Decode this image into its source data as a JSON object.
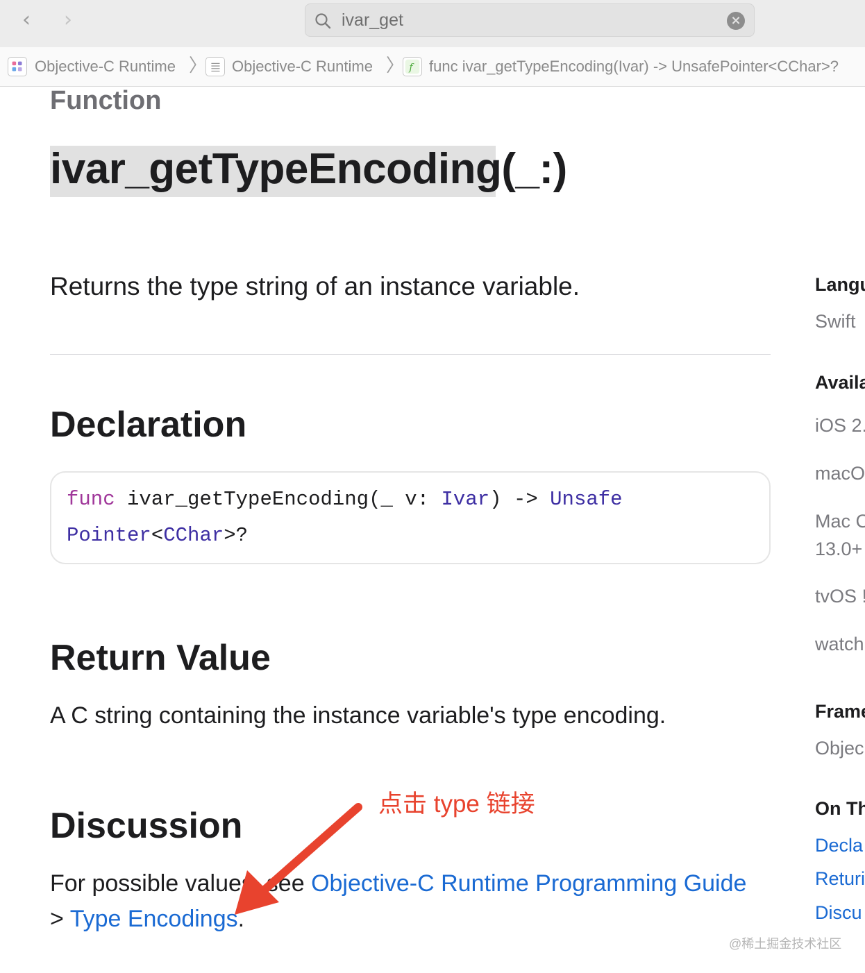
{
  "toolbar": {
    "back_icon": "chevron-left-icon",
    "forward_icon": "chevron-right-icon",
    "search": {
      "value": "ivar_get",
      "icon": "search-icon",
      "clear_icon": "clear-icon"
    }
  },
  "breadcrumb": {
    "items": [
      {
        "label": "Objective-C Runtime",
        "icon": "framework-icon"
      },
      {
        "label": "Objective-C Runtime",
        "icon": "list-icon"
      },
      {
        "label": "func ivar_getTypeEncoding(Ivar) -> UnsafePointer<CChar>?",
        "icon": "function-icon"
      }
    ]
  },
  "doc": {
    "kind": "Function",
    "title": "ivar_getTypeEncoding(_:)",
    "abstract": "Returns the type string of an instance variable.",
    "declaration": {
      "heading": "Declaration",
      "kw_func": "func",
      "name_open": " ivar_getTypeEncoding(_ v: ",
      "type_ivar": "Ivar",
      "arrow": ") -> ",
      "type_unsafe": "Unsafe",
      "type_pointer": "Pointer",
      "lt": "<",
      "type_cchar": "CChar",
      "tail": ">?"
    },
    "return_value": {
      "heading": "Return Value",
      "text": "A C string containing the instance variable's type encoding."
    },
    "discussion": {
      "heading": "Discussion",
      "prefix": "For possible values, see ",
      "link_guide": "Objective-C Runtime Programming Guide",
      "gt": "> ",
      "link_encodings": "Type Encodings",
      "suffix": "."
    }
  },
  "sidebar": {
    "language_heading": "Langu",
    "language_value": "Swift",
    "availability_heading": "Availa",
    "availability": [
      "iOS 2.",
      "macO",
      "Mac C",
      "13.0+",
      "tvOS !",
      "watch"
    ],
    "framework_heading": "Frame",
    "framework_value": "Objec",
    "on_this_page_heading": "On Th",
    "on_this_page_links": [
      "Decla",
      "Returi",
      "Discu"
    ]
  },
  "annotation": {
    "text": "点击 type 链接",
    "color": "#e8432e"
  },
  "watermark": "@稀土掘金技术社区"
}
